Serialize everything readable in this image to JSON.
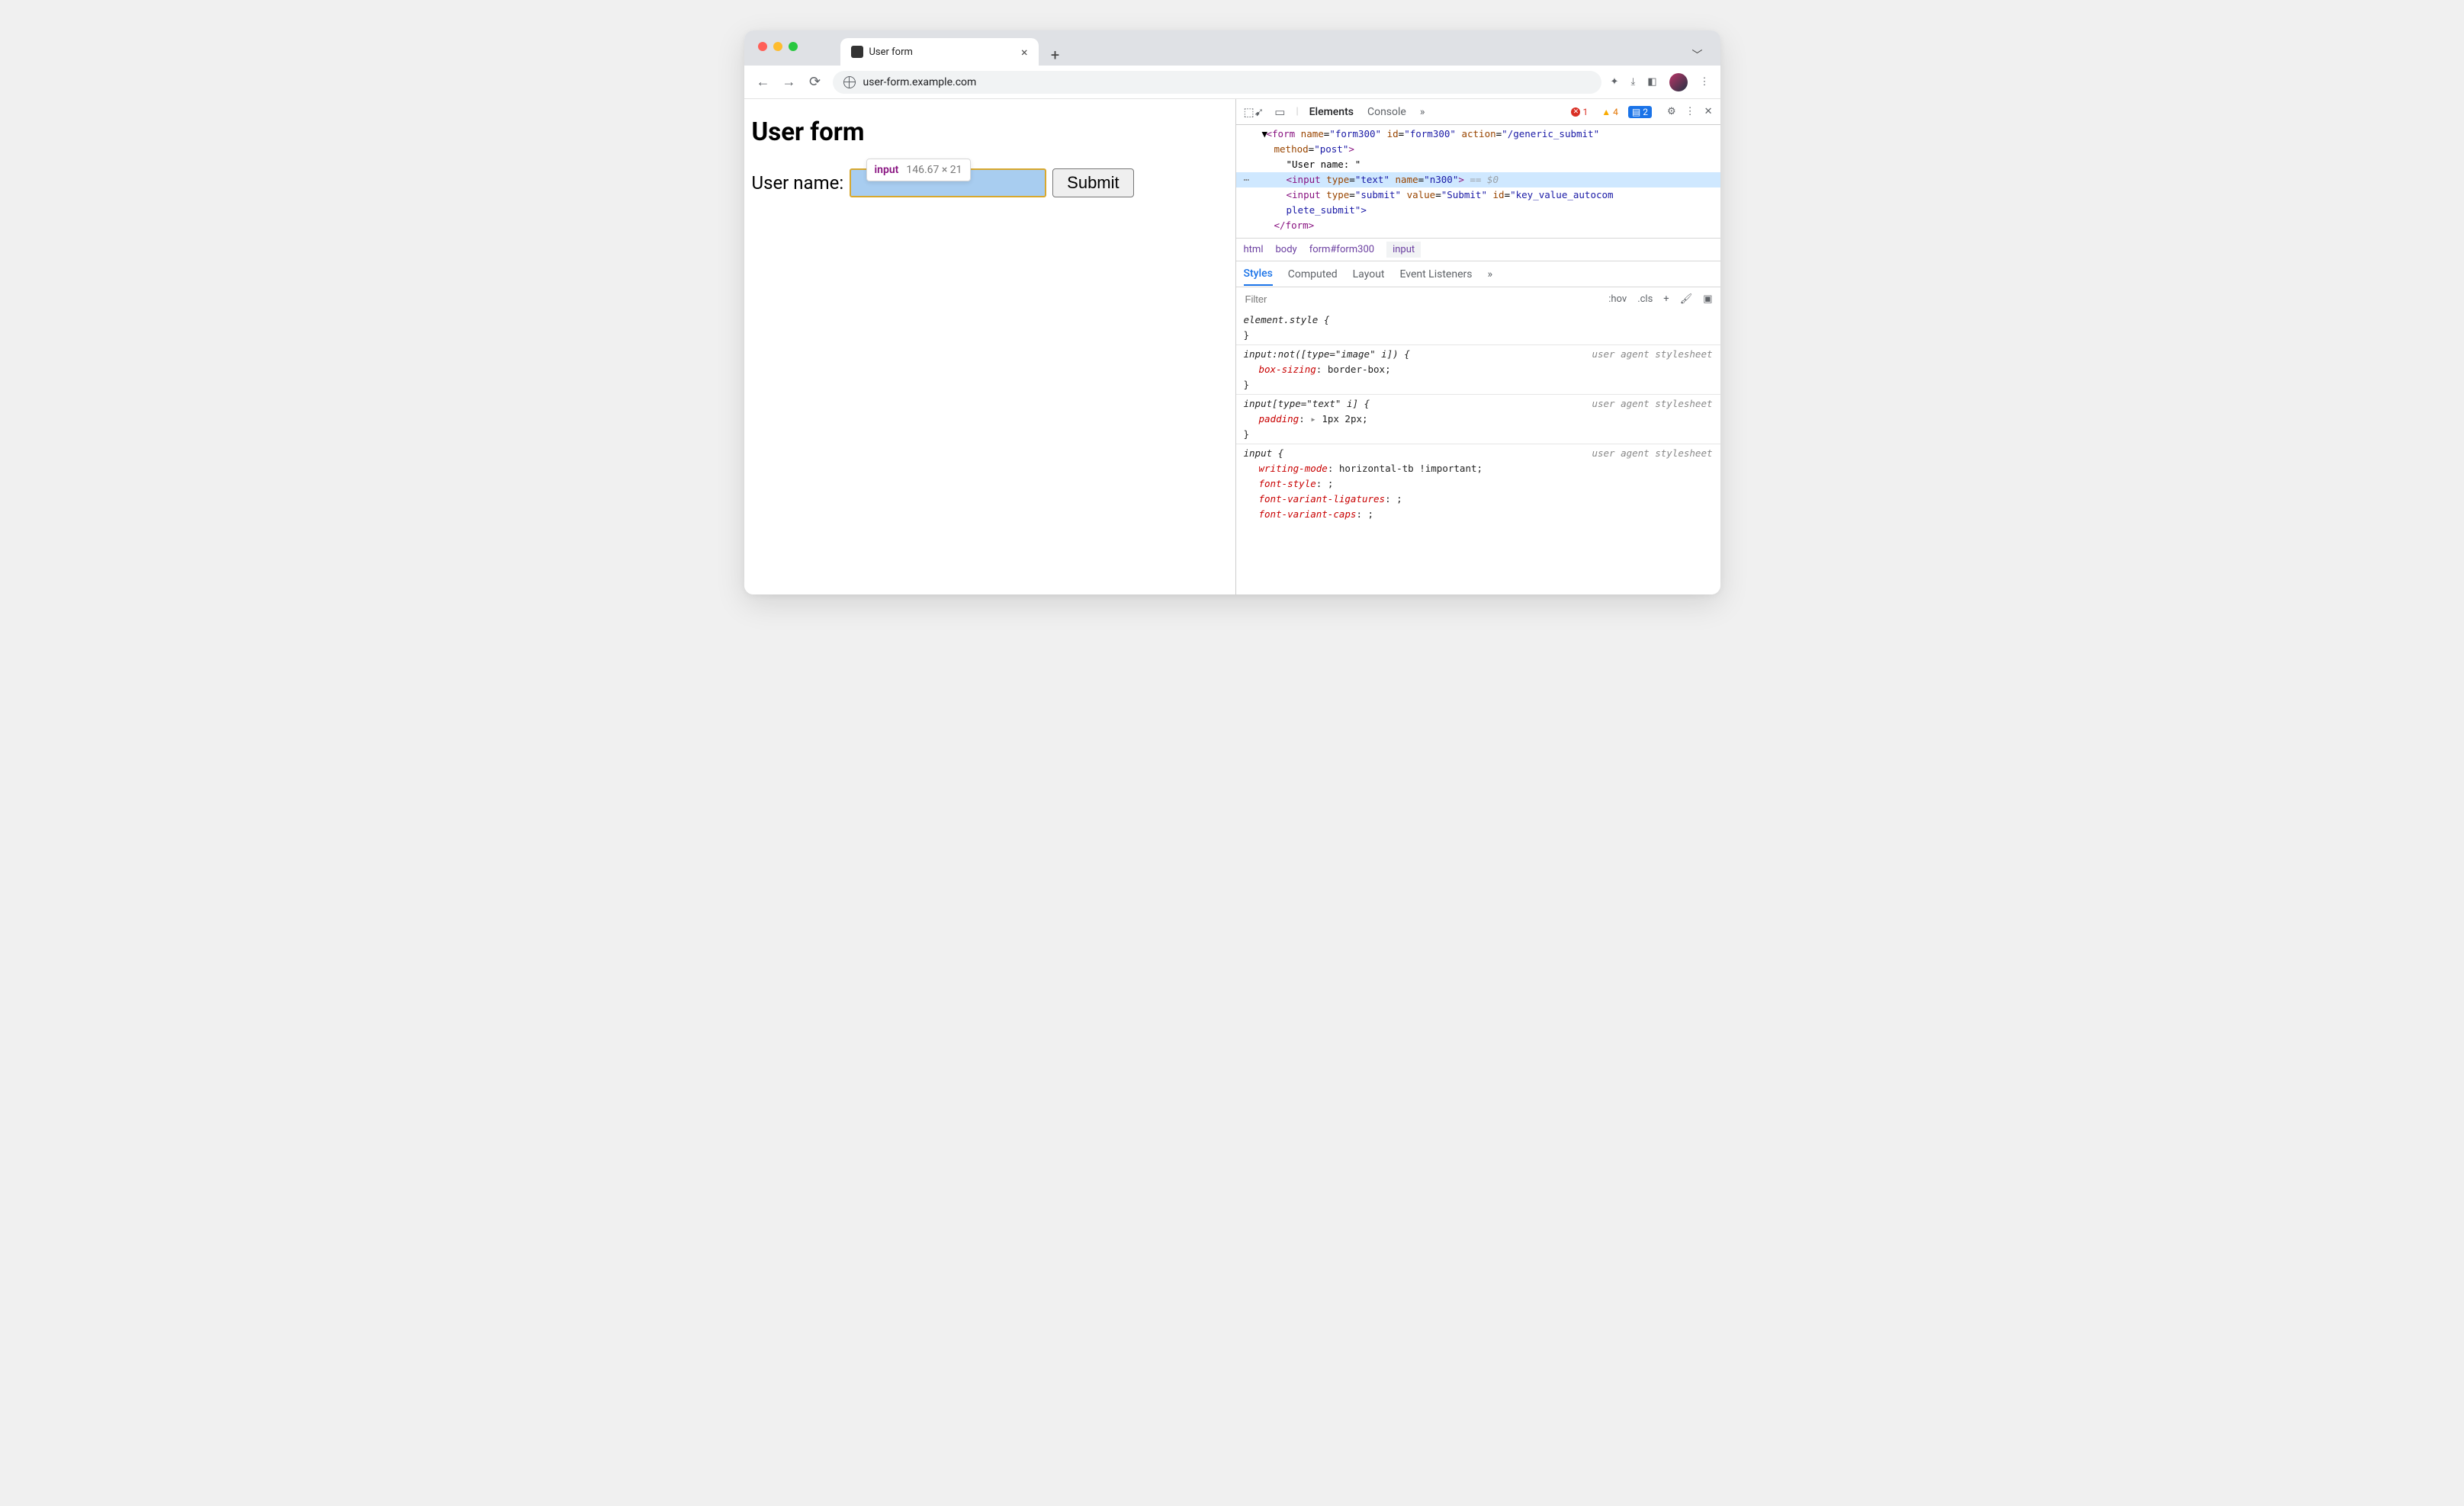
{
  "browser": {
    "tab_title": "User form",
    "url": "user-form.example.com"
  },
  "page": {
    "heading": "User form",
    "label": "User name:",
    "submit": "Submit"
  },
  "inspect_tooltip": {
    "tag": "input",
    "dimensions": "146.67 × 21"
  },
  "devtools": {
    "panels": {
      "elements": "Elements",
      "console": "Console",
      "more": "»"
    },
    "badges": {
      "errors": "1",
      "warnings": "4",
      "issues": "2"
    },
    "dom": {
      "form_open": {
        "tag": "form",
        "name_attr": "form300",
        "id_attr": "form300",
        "action_attr": "/generic_submit",
        "method_attr": "post"
      },
      "text_node": "\"User name: \"",
      "input_text": {
        "tag": "input",
        "type": "text",
        "name": "n300",
        "trailer": " == $0"
      },
      "input_submit": {
        "tag": "input",
        "type": "submit",
        "value": "Submit",
        "id": "key_value_autocom"
      },
      "input_submit_wrap": "plete_submit\">",
      "form_close": "</form>"
    },
    "breadcrumb": [
      "html",
      "body",
      "form#form300",
      "input"
    ],
    "styles": {
      "tabs": {
        "styles": "Styles",
        "computed": "Computed",
        "layout": "Layout",
        "events": "Event Listeners",
        "more": "»"
      },
      "filter_placeholder": "Filter",
      "tools": {
        "hov": ":hov",
        "cls": ".cls",
        "plus": "+"
      },
      "rules": [
        {
          "selector": "element.style {",
          "close": "}",
          "source": ""
        },
        {
          "selector": "input:not([type=\"image\" i]) {",
          "props": [
            {
              "name": "box-sizing",
              "value": "border-box;"
            }
          ],
          "close": "}",
          "source": "user agent stylesheet"
        },
        {
          "selector": "input[type=\"text\" i] {",
          "props": [
            {
              "name": "padding",
              "value": "1px 2px;",
              "expand": true
            }
          ],
          "close": "}",
          "source": "user agent stylesheet"
        },
        {
          "selector": "input {",
          "props": [
            {
              "name": "writing-mode",
              "value": "horizontal-tb !important;"
            },
            {
              "name": "font-style",
              "value": ";"
            },
            {
              "name": "font-variant-ligatures",
              "value": ";"
            },
            {
              "name": "font-variant-caps",
              "value": ";"
            }
          ],
          "source": "user agent stylesheet"
        }
      ]
    }
  }
}
